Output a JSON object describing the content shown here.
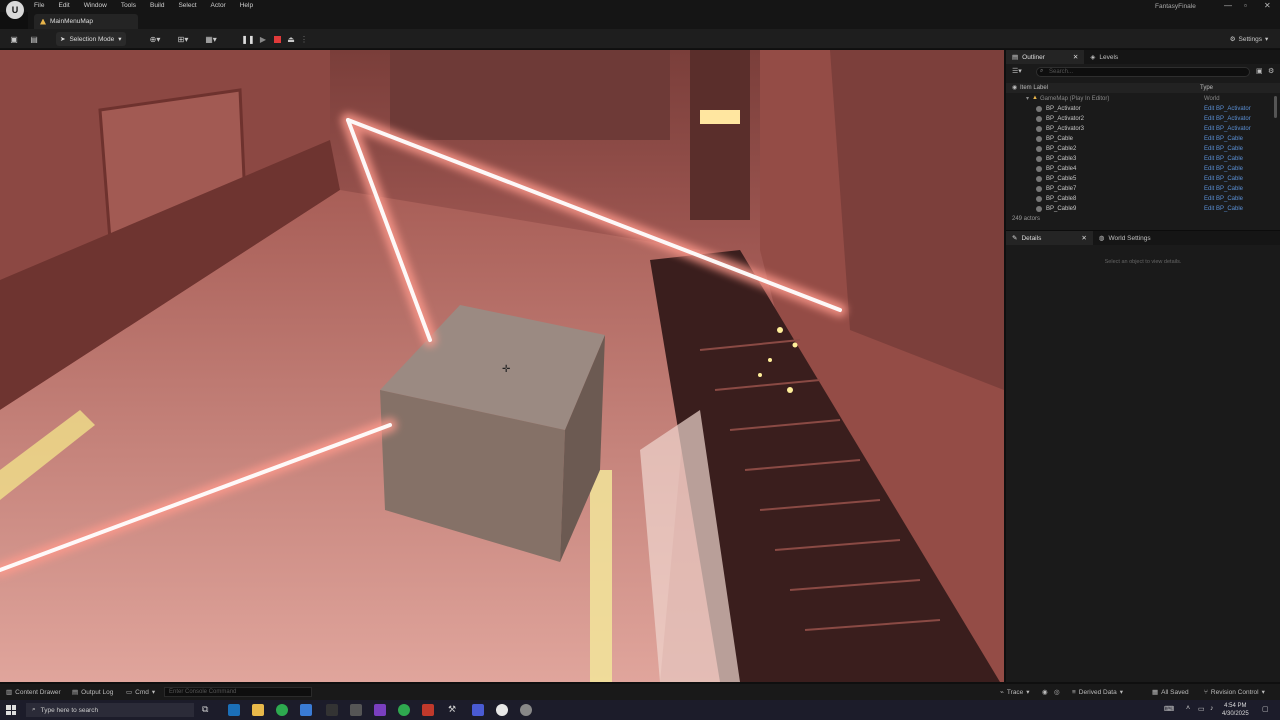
{
  "app": {
    "project_name": "FantasyFinale",
    "logo_text": "U",
    "menu": [
      "File",
      "Edit",
      "Window",
      "Tools",
      "Build",
      "Select",
      "Actor",
      "Help"
    ]
  },
  "tab": {
    "label": "MainMenuMap"
  },
  "toolbar": {
    "selection_mode": "Selection Mode",
    "settings_label": "Settings"
  },
  "outliner": {
    "tabs": [
      "Outliner",
      "Levels"
    ],
    "search_placeholder": "Search...",
    "columns": {
      "label": "Item Label",
      "type": "Type"
    },
    "rows": [
      {
        "label": "GameMap (Play In Editor)",
        "type": "World"
      },
      {
        "label": "BP_Activator",
        "type": "Edit BP_Activator"
      },
      {
        "label": "BP_Activator2",
        "type": "Edit BP_Activator"
      },
      {
        "label": "BP_Activator3",
        "type": "Edit BP_Activator"
      },
      {
        "label": "BP_Cable",
        "type": "Edit BP_Cable"
      },
      {
        "label": "BP_Cable2",
        "type": "Edit BP_Cable"
      },
      {
        "label": "BP_Cable3",
        "type": "Edit BP_Cable"
      },
      {
        "label": "BP_Cable4",
        "type": "Edit BP_Cable"
      },
      {
        "label": "BP_Cable5",
        "type": "Edit BP_Cable"
      },
      {
        "label": "BP_Cable7",
        "type": "Edit BP_Cable"
      },
      {
        "label": "BP_Cable8",
        "type": "Edit BP_Cable"
      },
      {
        "label": "BP_Cable9",
        "type": "Edit BP_Cable"
      }
    ],
    "actor_count": "249 actors"
  },
  "details": {
    "tabs": [
      "Details",
      "World Settings"
    ],
    "empty_message": "Select an object to view details."
  },
  "statusbar": {
    "content_drawer": "Content Drawer",
    "output_log": "Output Log",
    "cmd": "Cmd",
    "console_placeholder": "Enter Console Command",
    "trace": "Trace",
    "derived_data": "Derived Data",
    "all_saved": "All Saved",
    "revision_control": "Revision Control"
  },
  "taskbar": {
    "search_placeholder": "Type here to search",
    "time": "4:54 PM",
    "date": "4/30/2025"
  },
  "colors": {
    "accent_blue": "#5a8fd4",
    "laser": "#ffd8d0",
    "viewport_tint": "#8a4a46"
  }
}
